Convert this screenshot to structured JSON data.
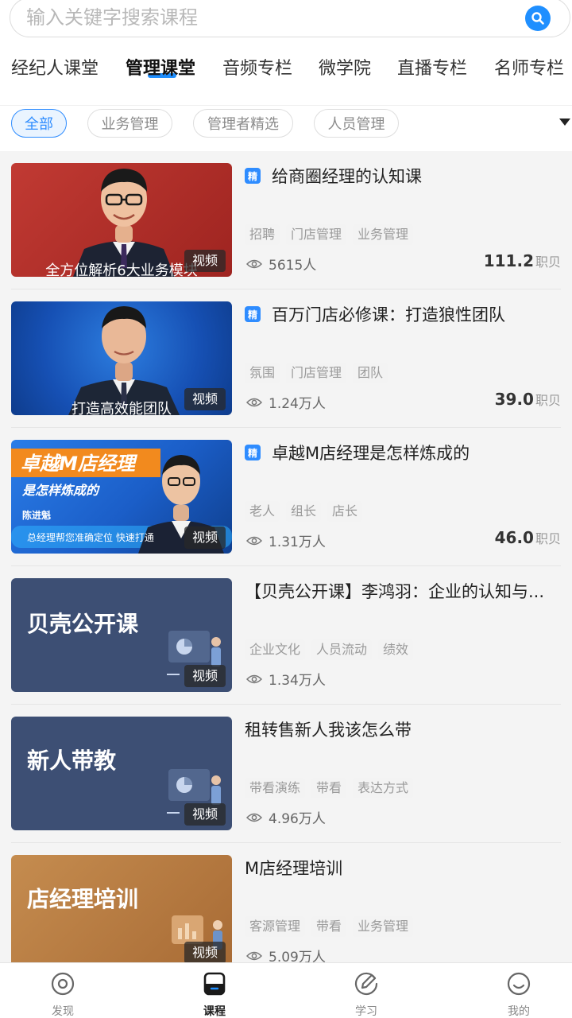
{
  "search": {
    "placeholder": "输入关键字搜索课程"
  },
  "tabs": [
    {
      "label": "经纪人课堂"
    },
    {
      "label": "管理课堂",
      "active": true
    },
    {
      "label": "音频专栏"
    },
    {
      "label": "微学院"
    },
    {
      "label": "直播专栏"
    },
    {
      "label": "名师专栏"
    }
  ],
  "filters": [
    {
      "label": "全部",
      "active": true
    },
    {
      "label": "业务管理"
    },
    {
      "label": "管理者精选"
    },
    {
      "label": "人员管理"
    }
  ],
  "badge_video": "视频",
  "badge_featured": "精",
  "courses": [
    {
      "featured": true,
      "title": "给商圈经理的认知课",
      "thumb_caption": "全方位解析6大业务模块",
      "tags": [
        "招聘",
        "门店管理",
        "业务管理"
      ],
      "views": "5615人",
      "price": "111.2",
      "price_unit": "职贝"
    },
    {
      "featured": true,
      "title": "百万门店必修课：打造狼性团队",
      "thumb_caption": "打造高效能团队",
      "tags": [
        "氛围",
        "门店管理",
        "团队"
      ],
      "views": "1.24万人",
      "price": "39.0",
      "price_unit": "职贝"
    },
    {
      "featured": true,
      "title": "卓越M店经理是怎样炼成的",
      "thumb_title": "卓越M店经理",
      "thumb_subtitle": "是怎样炼成的",
      "thumb_name": "陈进魁",
      "thumb_caption": "总经理帮您准确定位 快速打通",
      "tags": [
        "老人",
        "组长",
        "店长"
      ],
      "views": "1.31万人",
      "price": "46.0",
      "price_unit": "职贝"
    },
    {
      "featured": false,
      "title": "【贝壳公开课】李鸿羽：企业的认知与...",
      "thumb_title": "贝壳公开课",
      "tags": [
        "企业文化",
        "人员流动",
        "绩效"
      ],
      "views": "1.34万人"
    },
    {
      "featured": false,
      "title": "租转售新人我该怎么带",
      "thumb_title": "新人带教",
      "tags": [
        "带看演练",
        "带看",
        "表达方式"
      ],
      "views": "4.96万人"
    },
    {
      "featured": false,
      "title": "M店经理培训",
      "thumb_title": "店经理培训",
      "tags": [
        "客源管理",
        "带看",
        "业务管理"
      ],
      "views": "5.09万人"
    }
  ],
  "bottom_nav": [
    {
      "label": "发现",
      "icon": "target-icon"
    },
    {
      "label": "课程",
      "icon": "course-icon",
      "active": true
    },
    {
      "label": "学习",
      "icon": "pen-icon"
    },
    {
      "label": "我的",
      "icon": "smile-icon"
    }
  ],
  "colors": {
    "accent": "#1f8fff",
    "chip_active": "#2e8cff"
  }
}
